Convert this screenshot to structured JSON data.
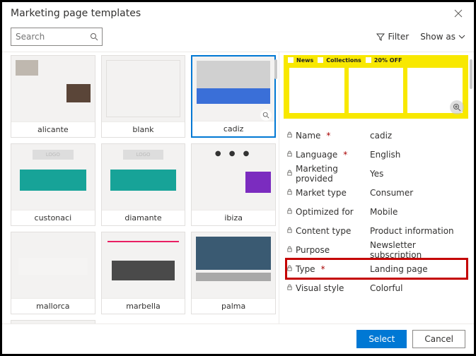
{
  "dialog": {
    "title": "Marketing page templates"
  },
  "search": {
    "placeholder": "Search"
  },
  "toolbar": {
    "filter_label": "Filter",
    "showas_label": "Show as"
  },
  "gallery": {
    "items": [
      {
        "label": "alicante",
        "thumb_class": "t-alicante",
        "selected": false
      },
      {
        "label": "blank",
        "thumb_class": "t-blank",
        "selected": false
      },
      {
        "label": "cadiz",
        "thumb_class": "t-cadiz",
        "selected": true
      },
      {
        "label": "custonaci",
        "thumb_class": "t-custonaci",
        "selected": false
      },
      {
        "label": "diamante",
        "thumb_class": "t-diamante",
        "selected": false
      },
      {
        "label": "ibiza",
        "thumb_class": "t-ibiza",
        "selected": false
      },
      {
        "label": "mallorca",
        "thumb_class": "t-mallorca",
        "selected": false
      },
      {
        "label": "marbella",
        "thumb_class": "t-marbella",
        "selected": false
      },
      {
        "label": "palma",
        "thumb_class": "t-palma",
        "selected": false
      },
      {
        "label": "",
        "thumb_class": "t-cam",
        "selected": false
      }
    ]
  },
  "preview": {
    "tabs": [
      "News",
      "Collections",
      "20% OFF"
    ]
  },
  "properties": [
    {
      "label": "Name",
      "value": "cadiz",
      "required": true,
      "highlight": false
    },
    {
      "label": "Language",
      "value": "English",
      "required": true,
      "highlight": false
    },
    {
      "label": "Marketing provided",
      "value": "Yes",
      "required": false,
      "highlight": false
    },
    {
      "label": "Market type",
      "value": "Consumer",
      "required": false,
      "highlight": false
    },
    {
      "label": "Optimized for",
      "value": "Mobile",
      "required": false,
      "highlight": false
    },
    {
      "label": "Content type",
      "value": "Product information",
      "required": false,
      "highlight": false
    },
    {
      "label": "Purpose",
      "value": "Newsletter subscription",
      "required": false,
      "highlight": false
    },
    {
      "label": "Type",
      "value": "Landing page",
      "required": true,
      "highlight": true
    },
    {
      "label": "Visual style",
      "value": "Colorful",
      "required": false,
      "highlight": false
    }
  ],
  "footer": {
    "select_label": "Select",
    "cancel_label": "Cancel"
  }
}
